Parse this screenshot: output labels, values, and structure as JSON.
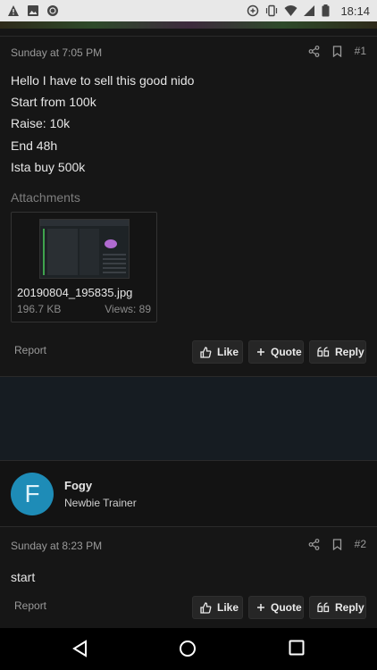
{
  "status_bar": {
    "time": "18:14",
    "left_icons": [
      "warning-icon",
      "image-icon",
      "sync-icon"
    ],
    "right_icons": [
      "data-saver-icon",
      "vibrate-icon",
      "wifi-icon",
      "signal-icon",
      "battery-icon"
    ]
  },
  "post1": {
    "timestamp": "Sunday at 7:05 PM",
    "number": "#1",
    "lines": [
      "Hello I have to sell this good nido",
      "Start from 100k",
      "Raise: 10k",
      "End 48h",
      "Ista buy 500k"
    ],
    "attachments_title": "Attachments",
    "attachment": {
      "filename": "20190804_195835.jpg",
      "size": "196.7 KB",
      "views": "Views: 89"
    },
    "report": "Report",
    "like": "Like",
    "quote": "Quote",
    "reply": "Reply"
  },
  "author": {
    "initial": "F",
    "name": "Fogy",
    "title": "Newbie Trainer",
    "avatar_color": "#1e8cb7"
  },
  "post2": {
    "timestamp": "Sunday at 8:23 PM",
    "number": "#2",
    "body": "start",
    "report": "Report",
    "like": "Like",
    "quote": "Quote",
    "reply": "Reply"
  },
  "nav_bar": {
    "icons": [
      "back-icon",
      "home-icon",
      "recents-icon"
    ]
  }
}
